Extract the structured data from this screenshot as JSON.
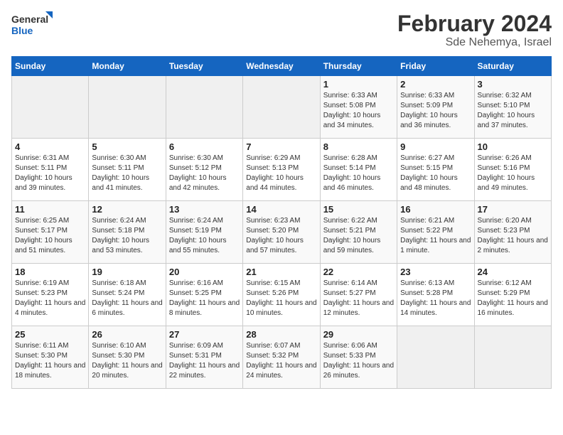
{
  "header": {
    "logo_general": "General",
    "logo_blue": "Blue",
    "month_year": "February 2024",
    "location": "Sde Nehemya, Israel"
  },
  "days_of_week": [
    "Sunday",
    "Monday",
    "Tuesday",
    "Wednesday",
    "Thursday",
    "Friday",
    "Saturday"
  ],
  "weeks": [
    [
      {
        "day": "",
        "info": ""
      },
      {
        "day": "",
        "info": ""
      },
      {
        "day": "",
        "info": ""
      },
      {
        "day": "",
        "info": ""
      },
      {
        "day": "1",
        "sunrise": "Sunrise: 6:33 AM",
        "sunset": "Sunset: 5:08 PM",
        "daylight": "Daylight: 10 hours and 34 minutes."
      },
      {
        "day": "2",
        "sunrise": "Sunrise: 6:33 AM",
        "sunset": "Sunset: 5:09 PM",
        "daylight": "Daylight: 10 hours and 36 minutes."
      },
      {
        "day": "3",
        "sunrise": "Sunrise: 6:32 AM",
        "sunset": "Sunset: 5:10 PM",
        "daylight": "Daylight: 10 hours and 37 minutes."
      }
    ],
    [
      {
        "day": "4",
        "sunrise": "Sunrise: 6:31 AM",
        "sunset": "Sunset: 5:11 PM",
        "daylight": "Daylight: 10 hours and 39 minutes."
      },
      {
        "day": "5",
        "sunrise": "Sunrise: 6:30 AM",
        "sunset": "Sunset: 5:11 PM",
        "daylight": "Daylight: 10 hours and 41 minutes."
      },
      {
        "day": "6",
        "sunrise": "Sunrise: 6:30 AM",
        "sunset": "Sunset: 5:12 PM",
        "daylight": "Daylight: 10 hours and 42 minutes."
      },
      {
        "day": "7",
        "sunrise": "Sunrise: 6:29 AM",
        "sunset": "Sunset: 5:13 PM",
        "daylight": "Daylight: 10 hours and 44 minutes."
      },
      {
        "day": "8",
        "sunrise": "Sunrise: 6:28 AM",
        "sunset": "Sunset: 5:14 PM",
        "daylight": "Daylight: 10 hours and 46 minutes."
      },
      {
        "day": "9",
        "sunrise": "Sunrise: 6:27 AM",
        "sunset": "Sunset: 5:15 PM",
        "daylight": "Daylight: 10 hours and 48 minutes."
      },
      {
        "day": "10",
        "sunrise": "Sunrise: 6:26 AM",
        "sunset": "Sunset: 5:16 PM",
        "daylight": "Daylight: 10 hours and 49 minutes."
      }
    ],
    [
      {
        "day": "11",
        "sunrise": "Sunrise: 6:25 AM",
        "sunset": "Sunset: 5:17 PM",
        "daylight": "Daylight: 10 hours and 51 minutes."
      },
      {
        "day": "12",
        "sunrise": "Sunrise: 6:24 AM",
        "sunset": "Sunset: 5:18 PM",
        "daylight": "Daylight: 10 hours and 53 minutes."
      },
      {
        "day": "13",
        "sunrise": "Sunrise: 6:24 AM",
        "sunset": "Sunset: 5:19 PM",
        "daylight": "Daylight: 10 hours and 55 minutes."
      },
      {
        "day": "14",
        "sunrise": "Sunrise: 6:23 AM",
        "sunset": "Sunset: 5:20 PM",
        "daylight": "Daylight: 10 hours and 57 minutes."
      },
      {
        "day": "15",
        "sunrise": "Sunrise: 6:22 AM",
        "sunset": "Sunset: 5:21 PM",
        "daylight": "Daylight: 10 hours and 59 minutes."
      },
      {
        "day": "16",
        "sunrise": "Sunrise: 6:21 AM",
        "sunset": "Sunset: 5:22 PM",
        "daylight": "Daylight: 11 hours and 1 minute."
      },
      {
        "day": "17",
        "sunrise": "Sunrise: 6:20 AM",
        "sunset": "Sunset: 5:23 PM",
        "daylight": "Daylight: 11 hours and 2 minutes."
      }
    ],
    [
      {
        "day": "18",
        "sunrise": "Sunrise: 6:19 AM",
        "sunset": "Sunset: 5:23 PM",
        "daylight": "Daylight: 11 hours and 4 minutes."
      },
      {
        "day": "19",
        "sunrise": "Sunrise: 6:18 AM",
        "sunset": "Sunset: 5:24 PM",
        "daylight": "Daylight: 11 hours and 6 minutes."
      },
      {
        "day": "20",
        "sunrise": "Sunrise: 6:16 AM",
        "sunset": "Sunset: 5:25 PM",
        "daylight": "Daylight: 11 hours and 8 minutes."
      },
      {
        "day": "21",
        "sunrise": "Sunrise: 6:15 AM",
        "sunset": "Sunset: 5:26 PM",
        "daylight": "Daylight: 11 hours and 10 minutes."
      },
      {
        "day": "22",
        "sunrise": "Sunrise: 6:14 AM",
        "sunset": "Sunset: 5:27 PM",
        "daylight": "Daylight: 11 hours and 12 minutes."
      },
      {
        "day": "23",
        "sunrise": "Sunrise: 6:13 AM",
        "sunset": "Sunset: 5:28 PM",
        "daylight": "Daylight: 11 hours and 14 minutes."
      },
      {
        "day": "24",
        "sunrise": "Sunrise: 6:12 AM",
        "sunset": "Sunset: 5:29 PM",
        "daylight": "Daylight: 11 hours and 16 minutes."
      }
    ],
    [
      {
        "day": "25",
        "sunrise": "Sunrise: 6:11 AM",
        "sunset": "Sunset: 5:30 PM",
        "daylight": "Daylight: 11 hours and 18 minutes."
      },
      {
        "day": "26",
        "sunrise": "Sunrise: 6:10 AM",
        "sunset": "Sunset: 5:30 PM",
        "daylight": "Daylight: 11 hours and 20 minutes."
      },
      {
        "day": "27",
        "sunrise": "Sunrise: 6:09 AM",
        "sunset": "Sunset: 5:31 PM",
        "daylight": "Daylight: 11 hours and 22 minutes."
      },
      {
        "day": "28",
        "sunrise": "Sunrise: 6:07 AM",
        "sunset": "Sunset: 5:32 PM",
        "daylight": "Daylight: 11 hours and 24 minutes."
      },
      {
        "day": "29",
        "sunrise": "Sunrise: 6:06 AM",
        "sunset": "Sunset: 5:33 PM",
        "daylight": "Daylight: 11 hours and 26 minutes."
      },
      {
        "day": "",
        "info": ""
      },
      {
        "day": "",
        "info": ""
      }
    ]
  ]
}
